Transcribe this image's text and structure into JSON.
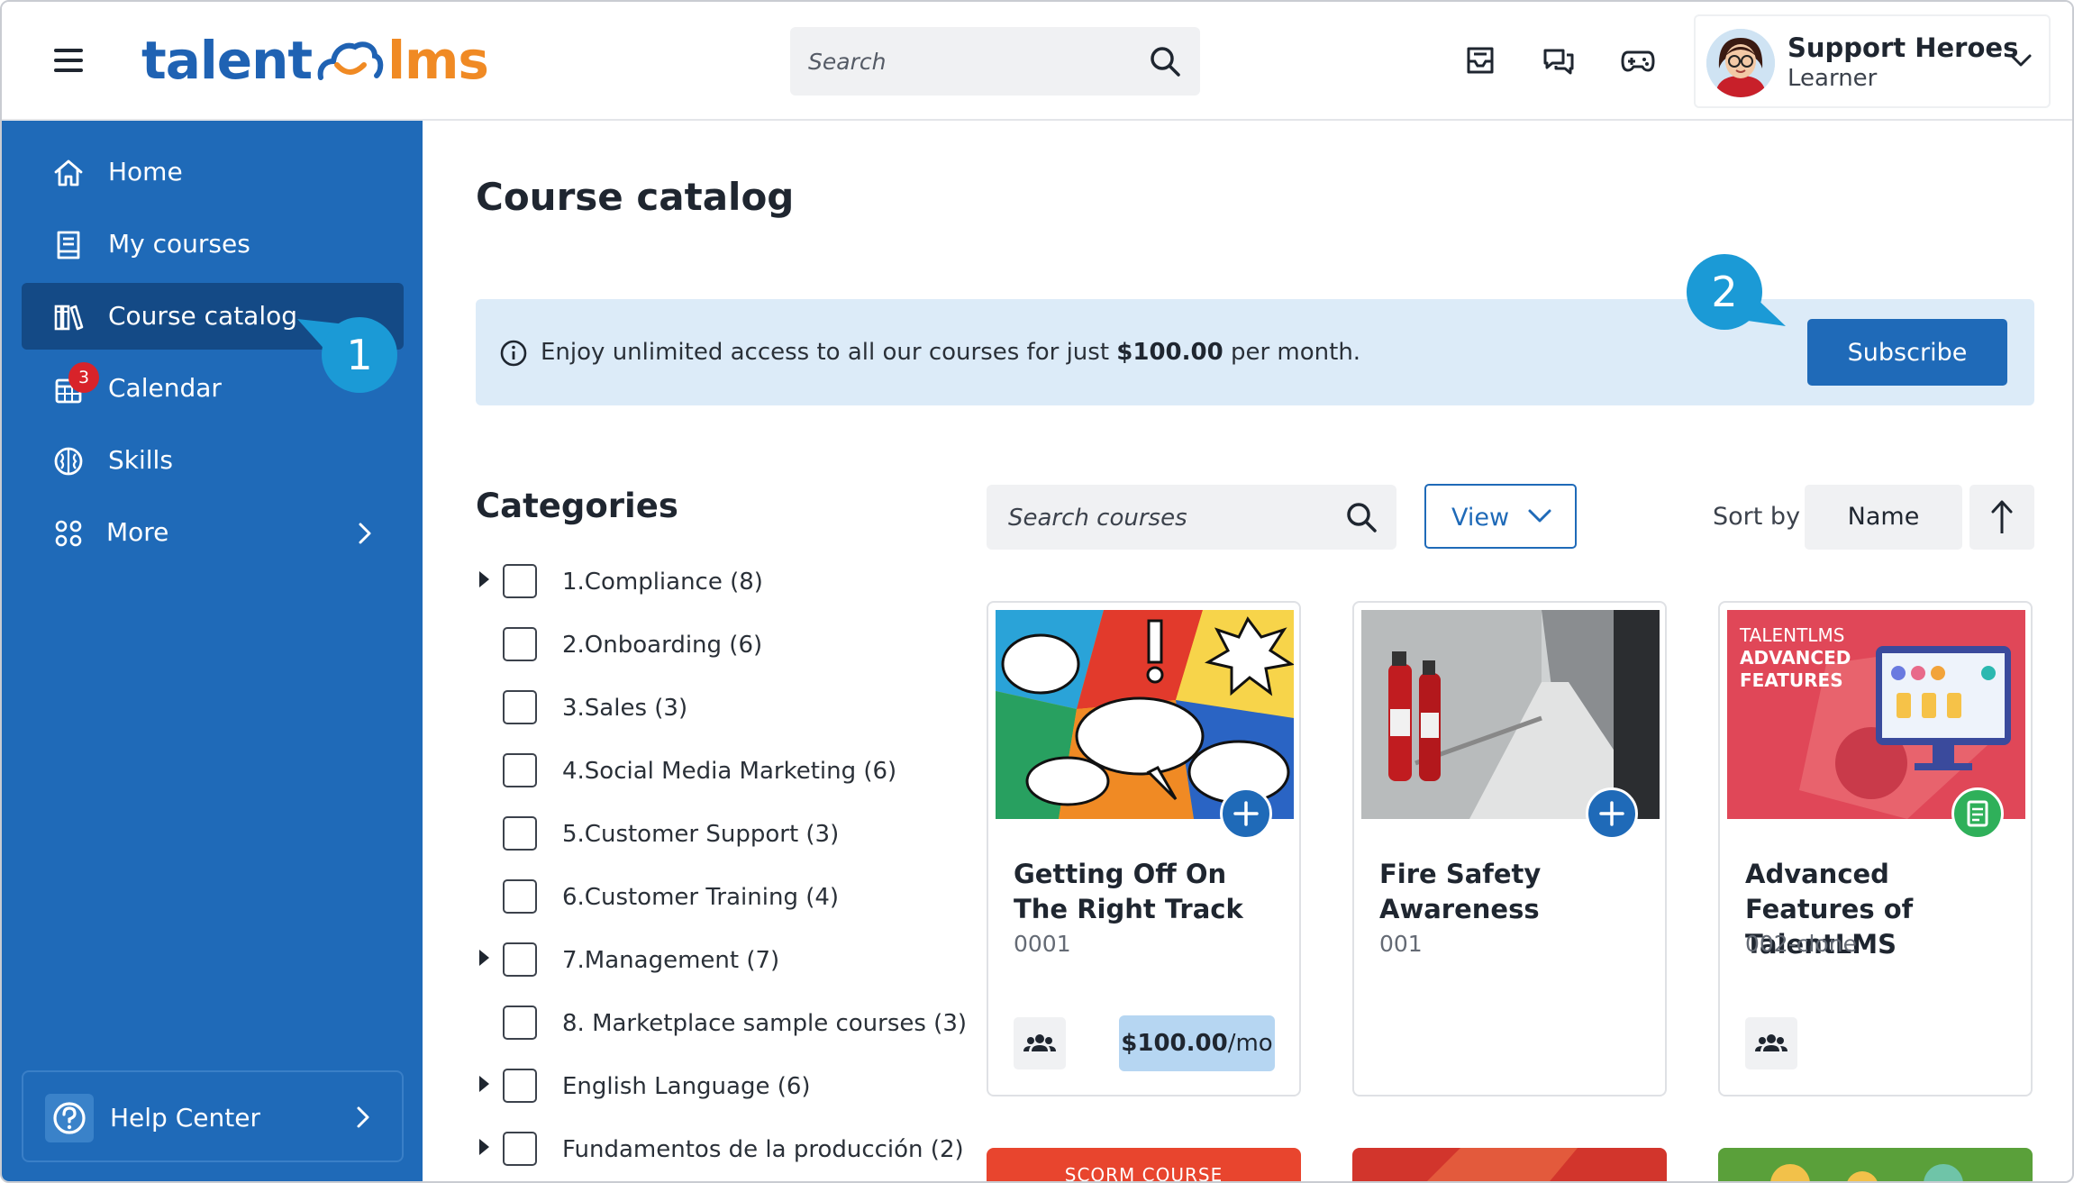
{
  "header": {
    "logo_left": "talent",
    "logo_right": "lms",
    "search_placeholder": "Search",
    "profile": {
      "name": "Support Heroes",
      "role": "Learner"
    }
  },
  "sidebar": {
    "items": [
      {
        "label": "Home",
        "icon": "home-icon"
      },
      {
        "label": "My courses",
        "icon": "book-icon"
      },
      {
        "label": "Course catalog",
        "icon": "library-icon",
        "active": true
      },
      {
        "label": "Calendar",
        "icon": "calendar-icon",
        "badge": "3"
      },
      {
        "label": "Skills",
        "icon": "brain-icon"
      },
      {
        "label": "More",
        "icon": "grid-icon"
      }
    ],
    "help_label": "Help Center"
  },
  "callouts": {
    "one": "1",
    "two": "2"
  },
  "main": {
    "title": "Course catalog",
    "banner": {
      "text_before": "Enjoy unlimited access to all our courses for just ",
      "price": "$100.00",
      "text_after": " per month.",
      "subscribe_label": "Subscribe"
    },
    "categories_title": "Categories",
    "categories": [
      {
        "label": "1.Compliance (8)",
        "expandable": true
      },
      {
        "label": "2.Onboarding (6)",
        "expandable": false
      },
      {
        "label": "3.Sales (3)",
        "expandable": false
      },
      {
        "label": "4.Social Media Marketing (6)",
        "expandable": false
      },
      {
        "label": "5.Customer Support (3)",
        "expandable": false
      },
      {
        "label": "6.Customer Training (4)",
        "expandable": false
      },
      {
        "label": "7.Management (7)",
        "expandable": true
      },
      {
        "label": "8. Marketplace sample courses (3)",
        "expandable": false
      },
      {
        "label": "English Language (6)",
        "expandable": true
      },
      {
        "label": "Fundamentos de la producción (2)",
        "expandable": true
      }
    ],
    "course_search_placeholder": "Search courses",
    "view_label": "View",
    "sort_by_label": "Sort by",
    "sort_field": "Name",
    "courses": [
      {
        "title": "Getting Off On The Right Track",
        "code": "0001",
        "price": "$100.00",
        "price_unit": "/mo"
      },
      {
        "title": "Fire Safety Awareness",
        "code": "001"
      },
      {
        "title": "Advanced Features of TalentLMS",
        "code": "002-clone",
        "thumb_text_1": "TALENTLMS",
        "thumb_text_2": "ADVANCED",
        "thumb_text_3": "FEATURES"
      }
    ],
    "next_row_label": "SCORM COURSE"
  },
  "colors": {
    "brand_blue": "#1f6ab8",
    "sidebar_active": "#144a86",
    "brand_orange": "#f08a24",
    "banner_bg": "#dcebf8",
    "callout": "#1b9ad6",
    "badge_red": "#d8232a",
    "price_bg": "#b6d6f2"
  }
}
